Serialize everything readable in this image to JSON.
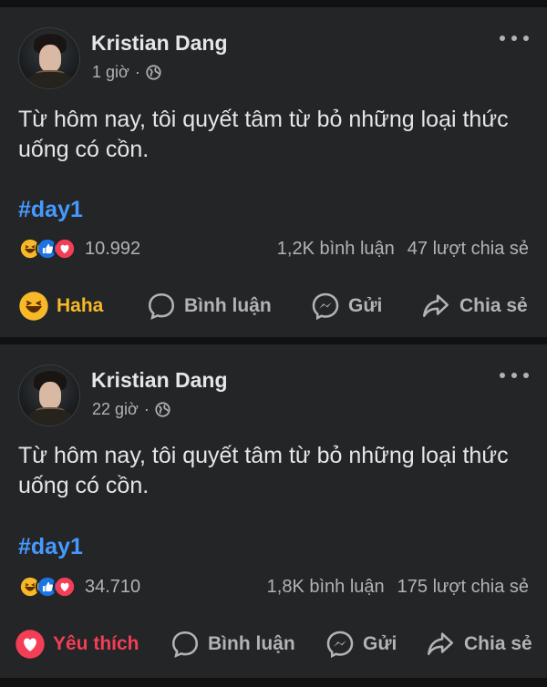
{
  "posts": [
    {
      "author": "Kristian Dang",
      "time": "1 giờ",
      "separator": "·",
      "text": "Từ hôm nay, tôi quyết tâm từ bỏ những loại thức uống có cồn.",
      "hashtag": "#day1",
      "reaction_count": "10.992",
      "comments": "1,2K bình luận",
      "shares": "47 lượt chia sẻ",
      "reaction_icons": [
        "haha-icon",
        "like-icon",
        "love-icon"
      ],
      "actions": {
        "react": "Haha",
        "comment": "Bình luận",
        "send": "Gửi",
        "share": "Chia sẻ"
      }
    },
    {
      "author": "Kristian Dang",
      "time": "22 giờ",
      "separator": "·",
      "text": "Từ hôm nay, tôi quyết tâm từ bỏ những loại thức uống có cồn.",
      "hashtag": "#day1",
      "reaction_count": "34.710",
      "comments": "1,8K bình luận",
      "shares": "175 lượt chia sẻ",
      "reaction_icons": [
        "haha-icon",
        "like-icon",
        "love-icon"
      ],
      "actions": {
        "react": "Yêu thích",
        "comment": "Bình luận",
        "send": "Gửi",
        "share": "Chia sẻ"
      }
    }
  ],
  "colors": {
    "background": "#111112",
    "card": "#242526",
    "text": "#e4e6eb",
    "muted": "#b0b3b8",
    "hashtag": "#4599ff",
    "haha": "#f7b928",
    "love": "#f33e58",
    "like": "#1b74e4"
  }
}
